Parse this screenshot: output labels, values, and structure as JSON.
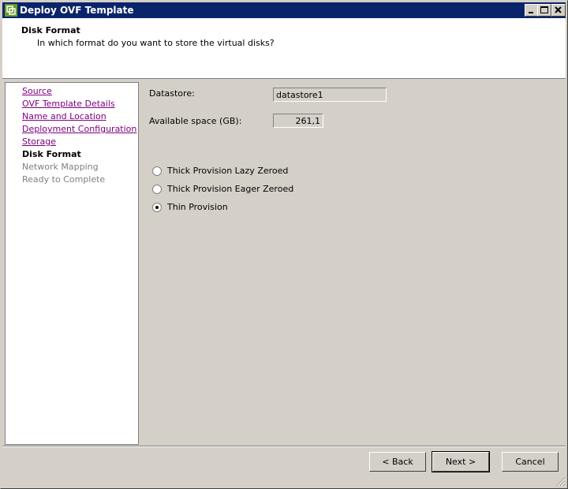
{
  "window": {
    "title": "Deploy OVF Template"
  },
  "header": {
    "title": "Disk Format",
    "subtitle": "In which format do you want to store the virtual disks?"
  },
  "nav": {
    "items": [
      {
        "label": "Source",
        "state": "link"
      },
      {
        "label": "OVF Template Details",
        "state": "link"
      },
      {
        "label": "Name and Location",
        "state": "link"
      },
      {
        "label": "Deployment Configuration",
        "state": "link"
      },
      {
        "label": "Storage",
        "state": "link"
      },
      {
        "label": "Disk Format",
        "state": "current"
      },
      {
        "label": "Network Mapping",
        "state": "disabled"
      },
      {
        "label": "Ready to Complete",
        "state": "disabled"
      }
    ]
  },
  "main": {
    "datastore_label": "Datastore:",
    "datastore_value": "datastore1",
    "space_label": "Available space (GB):",
    "space_value": "261,1",
    "options": [
      {
        "label": "Thick Provision Lazy Zeroed",
        "selected": false
      },
      {
        "label": "Thick Provision Eager Zeroed",
        "selected": false
      },
      {
        "label": "Thin Provision",
        "selected": true
      }
    ]
  },
  "buttons": {
    "back": "< Back",
    "next": "Next >",
    "cancel": "Cancel"
  },
  "colors": {
    "titlebar": "#0a246a",
    "link": "#800080",
    "disabled": "#808080",
    "dialog_bg": "#d4d0c8"
  }
}
